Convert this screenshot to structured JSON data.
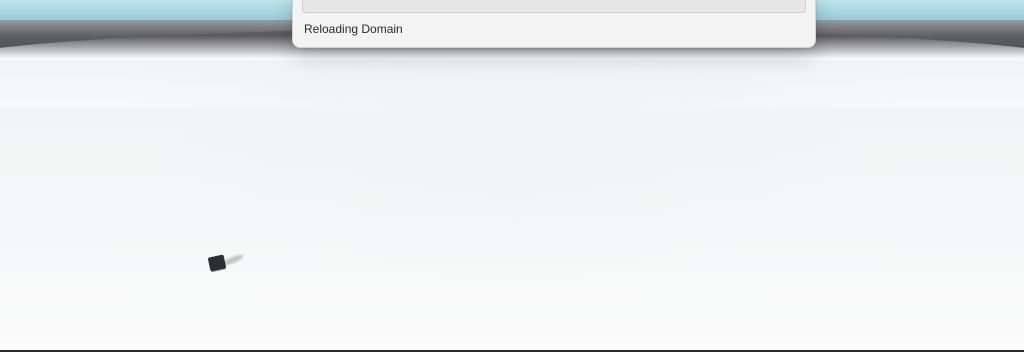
{
  "dialog": {
    "status_text": "Reloading Domain",
    "progress_fraction": 0
  },
  "scene": {
    "colors": {
      "sky": "#9cd0dd",
      "horizon": "#5c5c5f",
      "ground": "#fbfbfb",
      "object": "#2c2f30",
      "accent": "#2f79c9"
    }
  }
}
